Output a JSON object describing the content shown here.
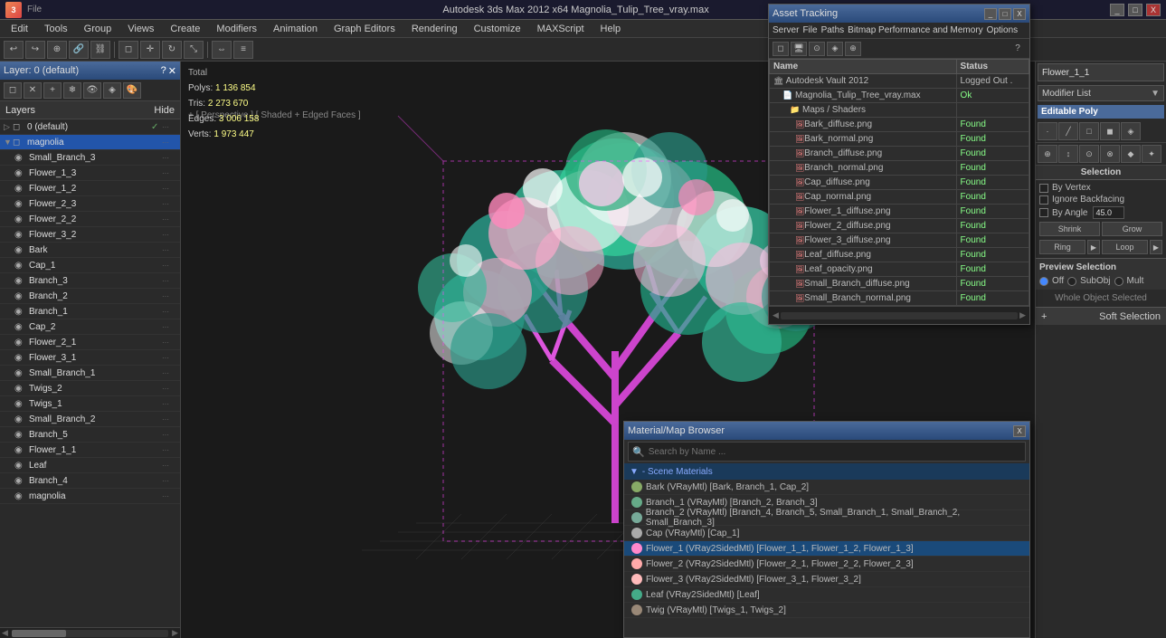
{
  "app": {
    "title": "Autodesk 3ds Max 2012 x64   Magnolia_Tulip_Tree_vray.max",
    "icon": "3ds"
  },
  "title_bar": {
    "controls": [
      "_",
      "□",
      "X"
    ]
  },
  "menu_bar": {
    "items": [
      "Edit",
      "Tools",
      "Group",
      "Views",
      "Create",
      "Modifiers",
      "Animation",
      "Graph Editors",
      "Rendering",
      "Customize",
      "MAXScript",
      "Help"
    ]
  },
  "viewport": {
    "label": "+ [ Perspective ] [ Shaded + Edged Faces ]",
    "stats": {
      "label": "Total",
      "polys_label": "Polys:",
      "polys_value": "1 136 854",
      "tris_label": "Tris:",
      "tris_value": "2 273 670",
      "edges_label": "Edges:",
      "edges_value": "3 006 158",
      "verts_label": "Verts:",
      "verts_value": "1 973 447"
    }
  },
  "layers_panel": {
    "title": "Layer: 0 (default)",
    "question": "?",
    "header_layers": "Layers",
    "header_hide": "Hide",
    "items": [
      {
        "name": "0 (default)",
        "indent": 0,
        "type": "layer",
        "checked": true,
        "expanded": false
      },
      {
        "name": "magnolia",
        "indent": 0,
        "type": "layer",
        "selected": true,
        "expanded": true
      },
      {
        "name": "Small_Branch_3",
        "indent": 1,
        "type": "object"
      },
      {
        "name": "Flower_1_3",
        "indent": 1,
        "type": "object"
      },
      {
        "name": "Flower_1_2",
        "indent": 1,
        "type": "object"
      },
      {
        "name": "Flower_2_3",
        "indent": 1,
        "type": "object"
      },
      {
        "name": "Flower_2_2",
        "indent": 1,
        "type": "object"
      },
      {
        "name": "Flower_3_2",
        "indent": 1,
        "type": "object"
      },
      {
        "name": "Bark",
        "indent": 1,
        "type": "object"
      },
      {
        "name": "Cap_1",
        "indent": 1,
        "type": "object"
      },
      {
        "name": "Branch_3",
        "indent": 1,
        "type": "object"
      },
      {
        "name": "Branch_2",
        "indent": 1,
        "type": "object"
      },
      {
        "name": "Branch_1",
        "indent": 1,
        "type": "object"
      },
      {
        "name": "Cap_2",
        "indent": 1,
        "type": "object"
      },
      {
        "name": "Flower_2_1",
        "indent": 1,
        "type": "object"
      },
      {
        "name": "Flower_3_1",
        "indent": 1,
        "type": "object"
      },
      {
        "name": "Small_Branch_1",
        "indent": 1,
        "type": "object"
      },
      {
        "name": "Twigs_2",
        "indent": 1,
        "type": "object"
      },
      {
        "name": "Twigs_1",
        "indent": 1,
        "type": "object"
      },
      {
        "name": "Small_Branch_2",
        "indent": 1,
        "type": "object"
      },
      {
        "name": "Branch_5",
        "indent": 1,
        "type": "object"
      },
      {
        "name": "Flower_1_1",
        "indent": 1,
        "type": "object"
      },
      {
        "name": "Leaf",
        "indent": 1,
        "type": "object"
      },
      {
        "name": "Branch_4",
        "indent": 1,
        "type": "object"
      },
      {
        "name": "magnolia",
        "indent": 1,
        "type": "object"
      }
    ]
  },
  "asset_tracking": {
    "title": "Asset Tracking",
    "menu": [
      "Server",
      "File",
      "Paths",
      "Bitmap Performance and Memory",
      "Options"
    ],
    "columns": [
      "Name",
      "Status"
    ],
    "rows": [
      {
        "indent": 0,
        "icon": "vault",
        "name": "Autodesk Vault 2012",
        "status": "Logged Out ."
      },
      {
        "indent": 1,
        "icon": "file",
        "name": "Magnolia_Tulip_Tree_vray.max",
        "status": "Ok"
      },
      {
        "indent": 2,
        "icon": "folder",
        "name": "Maps / Shaders",
        "status": ""
      },
      {
        "indent": 3,
        "icon": "img",
        "name": "Bark_diffuse.png",
        "status": "Found"
      },
      {
        "indent": 3,
        "icon": "img",
        "name": "Bark_normal.png",
        "status": "Found"
      },
      {
        "indent": 3,
        "icon": "img",
        "name": "Branch_diffuse.png",
        "status": "Found"
      },
      {
        "indent": 3,
        "icon": "img",
        "name": "Branch_normal.png",
        "status": "Found"
      },
      {
        "indent": 3,
        "icon": "img",
        "name": "Cap_diffuse.png",
        "status": "Found"
      },
      {
        "indent": 3,
        "icon": "img",
        "name": "Cap_normal.png",
        "status": "Found"
      },
      {
        "indent": 3,
        "icon": "img",
        "name": "Flower_1_diffuse.png",
        "status": "Found"
      },
      {
        "indent": 3,
        "icon": "img",
        "name": "Flower_2_diffuse.png",
        "status": "Found"
      },
      {
        "indent": 3,
        "icon": "img",
        "name": "Flower_3_diffuse.png",
        "status": "Found"
      },
      {
        "indent": 3,
        "icon": "img",
        "name": "Leaf_diffuse.png",
        "status": "Found"
      },
      {
        "indent": 3,
        "icon": "img",
        "name": "Leaf_opacity.png",
        "status": "Found"
      },
      {
        "indent": 3,
        "icon": "img",
        "name": "Small_Branch_diffuse.png",
        "status": "Found"
      },
      {
        "indent": 3,
        "icon": "img",
        "name": "Small_Branch_normal.png",
        "status": "Found"
      }
    ]
  },
  "right_panel": {
    "object_name": "Flower_1_1",
    "modifier_list_label": "Modifier List",
    "editable_poly_label": "Editable Poly",
    "icons_row1": [
      "■",
      "✦",
      "▼",
      "↩",
      "↗"
    ],
    "icons_row2": [
      "◆",
      "◈",
      "⊕",
      "⊗",
      "⊙"
    ],
    "selection_title": "Selection",
    "by_vertex_label": "By Vertex",
    "ignore_backfacing_label": "Ignore Backfacing",
    "by_angle_label": "By Angle",
    "by_angle_value": "45.0",
    "shrink_label": "Shrink",
    "grow_label": "Grow",
    "ring_label": "Ring",
    "loop_label": "Loop",
    "preview_selection_title": "Preview Selection",
    "radio_off": "Off",
    "radio_subobj": "SubObj",
    "radio_mult": "Mult",
    "whole_object_selected": "Whole Object Selected",
    "soft_selection_title": "Soft Selection"
  },
  "material_browser": {
    "title": "Material/Map Browser",
    "search_placeholder": "Search by Name ...",
    "scene_materials_label": "- Scene Materials",
    "items": [
      {
        "name": "Bark",
        "detail": "(VRayMtl) [Bark, Branch_1, Cap_2]",
        "selected": false
      },
      {
        "name": "Branch_1",
        "detail": "(VRayMtl) [Branch_2, Branch_3]",
        "selected": false
      },
      {
        "name": "Branch_2",
        "detail": "(VRayMtl) [Branch_4, Branch_5, Small_Branch_1, Small_Branch_2, Small_Branch_3]",
        "selected": false
      },
      {
        "name": "Cap",
        "detail": "(VRayMtl) [Cap_1]",
        "selected": false
      },
      {
        "name": "Flower_1",
        "detail": "(VRay2SidedMtl) [Flower_1_1, Flower_1_2, Flower_1_3]",
        "selected": true
      },
      {
        "name": "Flower_2",
        "detail": "(VRay2SidedMtl) [Flower_2_1, Flower_2_2, Flower_2_3]",
        "selected": false
      },
      {
        "name": "Flower_3",
        "detail": "(VRay2SidedMtl) [Flower_3_1, Flower_3_2]",
        "selected": false
      },
      {
        "name": "Leaf",
        "detail": "(VRay2SidedMtl) [Leaf]",
        "selected": false
      },
      {
        "name": "Twig",
        "detail": "(VRayMtl) [Twigs_1, Twigs_2]",
        "selected": false
      }
    ]
  }
}
